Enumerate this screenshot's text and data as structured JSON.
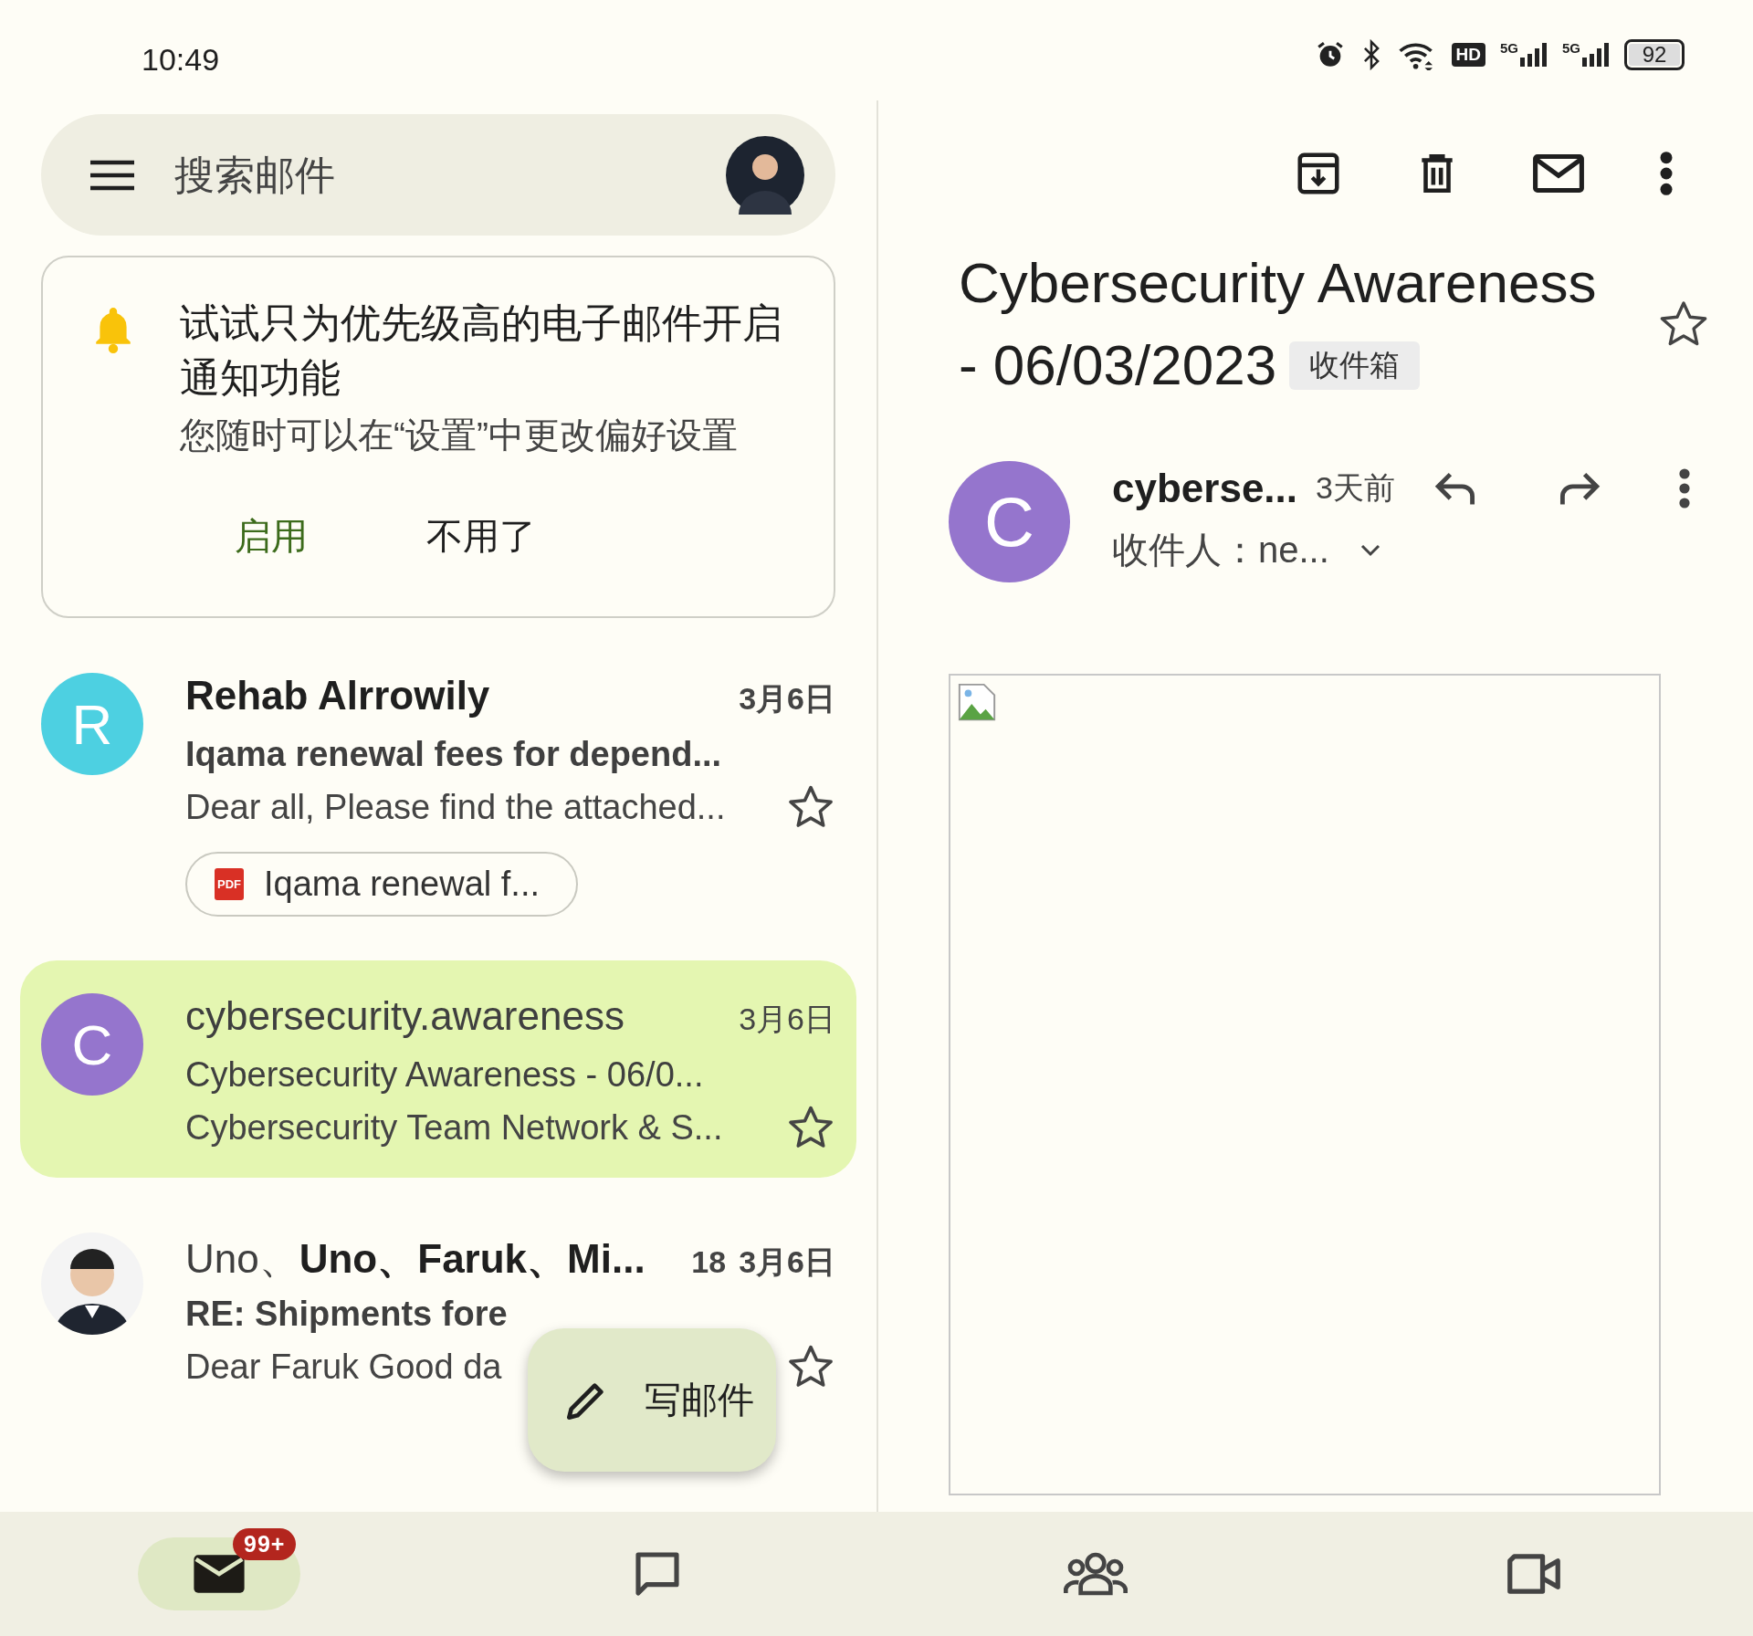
{
  "status_bar": {
    "time": "10:49",
    "hd": "HD",
    "networks": [
      "5G",
      "5G"
    ],
    "battery": "92"
  },
  "search": {
    "placeholder": "搜索邮件"
  },
  "notification": {
    "title": "试试只为优先级高的电子邮件开启通知功能",
    "subtitle": "您随时可以在“设置”中更改偏好设置",
    "buttons": [
      {
        "label": "启用",
        "kind": "primary"
      },
      {
        "label": "不用了",
        "kind": "secondary"
      }
    ]
  },
  "messages": [
    {
      "avatar": {
        "kind": "letter",
        "letter": "R",
        "color": "#4dd0e1"
      },
      "participants": [
        {
          "name": "Rehab Alrrowily",
          "unread": true
        }
      ],
      "date": "3月6日",
      "subject": "Iqama renewal fees for depend...",
      "snippet": "Dear all, Please find the attached...",
      "unread": true,
      "selected": false,
      "starred": false,
      "attachment": {
        "file_type": "PDF",
        "name": "Iqama renewal f..."
      }
    },
    {
      "avatar": {
        "kind": "letter",
        "letter": "C",
        "color": "#9575cd"
      },
      "participants": [
        {
          "name": "cybersecurity.awareness",
          "unread": false
        }
      ],
      "date": "3月6日",
      "subject": "Cybersecurity Awareness - 06/0...",
      "snippet": "Cybersecurity Team Network & S...",
      "unread": false,
      "selected": true,
      "starred": false
    },
    {
      "participants": [
        {
          "name": "Uno、",
          "unread": false
        },
        {
          "name": "Uno、",
          "unread": true
        },
        {
          "name": "Faruk、",
          "unread": true
        },
        {
          "name": "Mi...",
          "unread": true
        }
      ],
      "count": "18",
      "date": "3月6日",
      "subject": "RE: Shipments fore",
      "snippet": "Dear Faruk Good da",
      "unread": true,
      "selected": false,
      "starred": false
    }
  ],
  "compose": {
    "label": "写邮件"
  },
  "email": {
    "title_lines": [
      "Cybersecurity Awareness",
      "- 06/03/2023"
    ],
    "label": "收件箱",
    "starred": false,
    "sender": {
      "name": "cyberse...",
      "initial": "C",
      "color": "#9575cd"
    },
    "time": "3天前",
    "to_label": "收件人：",
    "to": "ne..."
  },
  "bottom_nav": [
    {
      "kind": "mail",
      "selected": true,
      "badge": "99+"
    },
    {
      "kind": "chat",
      "selected": false
    },
    {
      "kind": "people",
      "selected": false
    },
    {
      "kind": "video",
      "selected": false
    }
  ]
}
